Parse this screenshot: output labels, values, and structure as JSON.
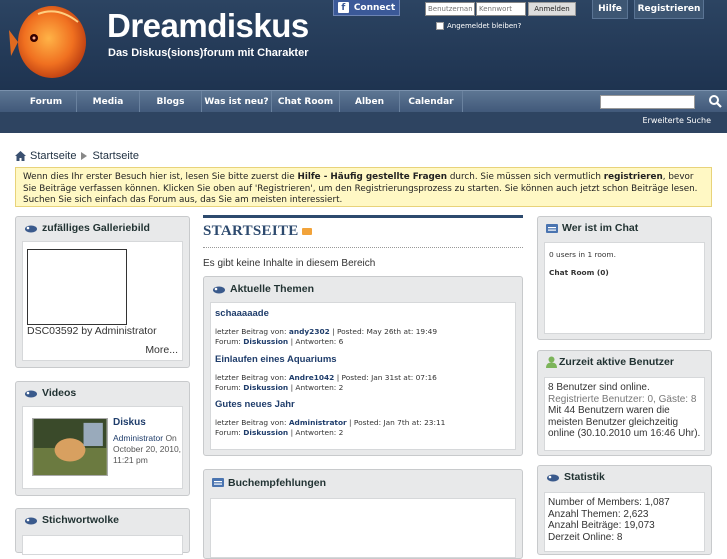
{
  "header": {
    "logo": "Dreamdiskus",
    "tagline": "Das Diskus(sions)forum mit Charakter",
    "facebook_connect": "Connect",
    "username_placeholder": "Benutzername",
    "password_placeholder": "Kennwort",
    "login_label": "Anmelden",
    "remember_label": "Angemeldet bleiben?",
    "help_label": "Hilfe",
    "register_label": "Registrieren"
  },
  "nav": {
    "items": [
      "Forum",
      "Media",
      "Blogs",
      "Was ist neu?",
      "Chat Room",
      "Alben",
      "Calendar"
    ],
    "advanced_search": "Erweiterte Suche"
  },
  "breadcrumb": {
    "home": "Startseite",
    "current": "Startseite"
  },
  "notice": {
    "p1": "Wenn dies Ihr erster Besuch hier ist, lesen Sie bitte zuerst die ",
    "faq": "Hilfe - Häufig gestellte Fragen",
    "p2": " durch. Sie müssen sich vermutlich ",
    "register": "registrieren",
    "p3": ", bevor Sie Beiträge verfassen können. Klicken Sie oben auf 'Registrieren', um den Registrierungsprozess zu starten. Sie können auch jetzt schon Beiträge lesen. Suchen Sie sich einfach das Forum aus, das Sie am meisten interessiert."
  },
  "left": {
    "gallery": {
      "title": "zufälliges Galleriebild",
      "caption": "DSC03592 by Administrator",
      "more": "More..."
    },
    "videos": {
      "title": "Videos",
      "video_title": "Diskus",
      "video_author": "Administrator",
      "video_date_on": " On",
      "video_date": "October 20, 2010, 11:21 pm"
    },
    "tags": {
      "title": "Stichwortwolke"
    }
  },
  "center": {
    "title": "STARTSEITE",
    "empty": "Es gibt keine Inhalte in diesem Bereich",
    "topics_title": "Aktuelle Themen",
    "topics": [
      {
        "title": "schaaaaade",
        "last_label": "letzter Beitrag von:",
        "author": "andy2302",
        "posted": "| Posted: May 26th at: 19:49",
        "forum_label": "Forum:",
        "forum": "Diskussion",
        "replies": "| Antworten: 6"
      },
      {
        "title": "Einlaufen eines Aquariums",
        "last_label": "letzter Beitrag von:",
        "author": "Andre1042",
        "posted": "| Posted: Jan 31st at: 07:16",
        "forum_label": "Forum:",
        "forum": "Diskussion",
        "replies": "| Antworten: 2"
      },
      {
        "title": "Gutes neues Jahr",
        "last_label": "letzter Beitrag von:",
        "author": "Administrator",
        "posted": "| Posted: Jan 7th at: 23:11",
        "forum_label": "Forum:",
        "forum": "Diskussion",
        "replies": "| Antworten: 2"
      }
    ],
    "books_title": "Buchempfehlungen"
  },
  "right": {
    "chat": {
      "title": "Wer ist im Chat",
      "users": "0 users in 1 room.",
      "room": "Chat Room (0)"
    },
    "active": {
      "title": "Zurzeit aktive Benutzer",
      "l1": "8 Benutzer sind online.",
      "l2": "Registrierte Benutzer: 0, Gäste: 8",
      "l3": "Mit 44 Benutzern waren die meisten Benutzer gleichzeitig online (30.10.2010 um 16:46 Uhr)."
    },
    "stats": {
      "title": "Statistik",
      "members": "Number of Members: 1,087",
      "threads": "Anzahl Themen: 2,623",
      "posts": "Anzahl Beiträge: 19,073",
      "online": "Derzeit Online: 8"
    }
  }
}
